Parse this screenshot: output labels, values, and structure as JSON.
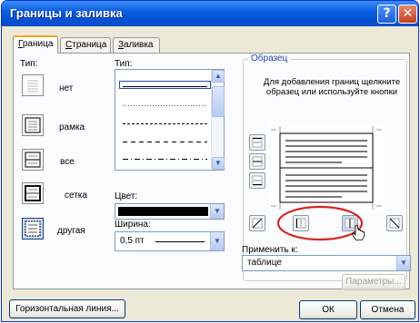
{
  "window": {
    "title": "Границы и заливка",
    "help_label": "?",
    "close_label": "✕"
  },
  "tabs": [
    {
      "label": "Граница",
      "mnemonic_prefix": "",
      "mnemonic": "Г",
      "rest": "раница",
      "active": true
    },
    {
      "label": "Страница",
      "mnemonic_prefix": "",
      "mnemonic": "С",
      "rest": "траница",
      "active": false
    },
    {
      "label": "Заливка",
      "mnemonic_prefix": "",
      "mnemonic": "З",
      "rest": "аливка",
      "active": false
    }
  ],
  "type_section": {
    "label": "Тип:",
    "presets": [
      {
        "label": "нет",
        "icon": "border-none-icon",
        "selected": false
      },
      {
        "label": "рамка",
        "icon": "border-box-icon",
        "selected": false
      },
      {
        "label": "все",
        "icon": "border-all-icon",
        "selected": false
      },
      {
        "label": "сетка",
        "icon": "border-grid-icon",
        "selected": false
      },
      {
        "label": "другая",
        "icon": "border-custom-icon",
        "selected": true
      }
    ]
  },
  "style_section": {
    "label": "Тип:",
    "line_styles": [
      "solid",
      "dotted",
      "dashed-fine",
      "dashed",
      "dash-dot"
    ]
  },
  "color_section": {
    "label": "Цвет:",
    "value_color": "#000000"
  },
  "width_section": {
    "label": "Ширина:",
    "value": "0,5 пт"
  },
  "preview_section": {
    "label": "Образец",
    "hint": "Для добавления границ щелкните образец или используйте кнопки"
  },
  "apply_section": {
    "label": "Применить к:",
    "value": "таблице"
  },
  "buttons": {
    "parameters": "Параметры...",
    "horizontal_line": "Горизонтальная линия...",
    "ok": "ОК",
    "cancel": "Отмена"
  },
  "colors": {
    "title_bar": "#0a5ee0",
    "highlight_ring": "#d7261e",
    "accent_tab": "#f5a623"
  }
}
